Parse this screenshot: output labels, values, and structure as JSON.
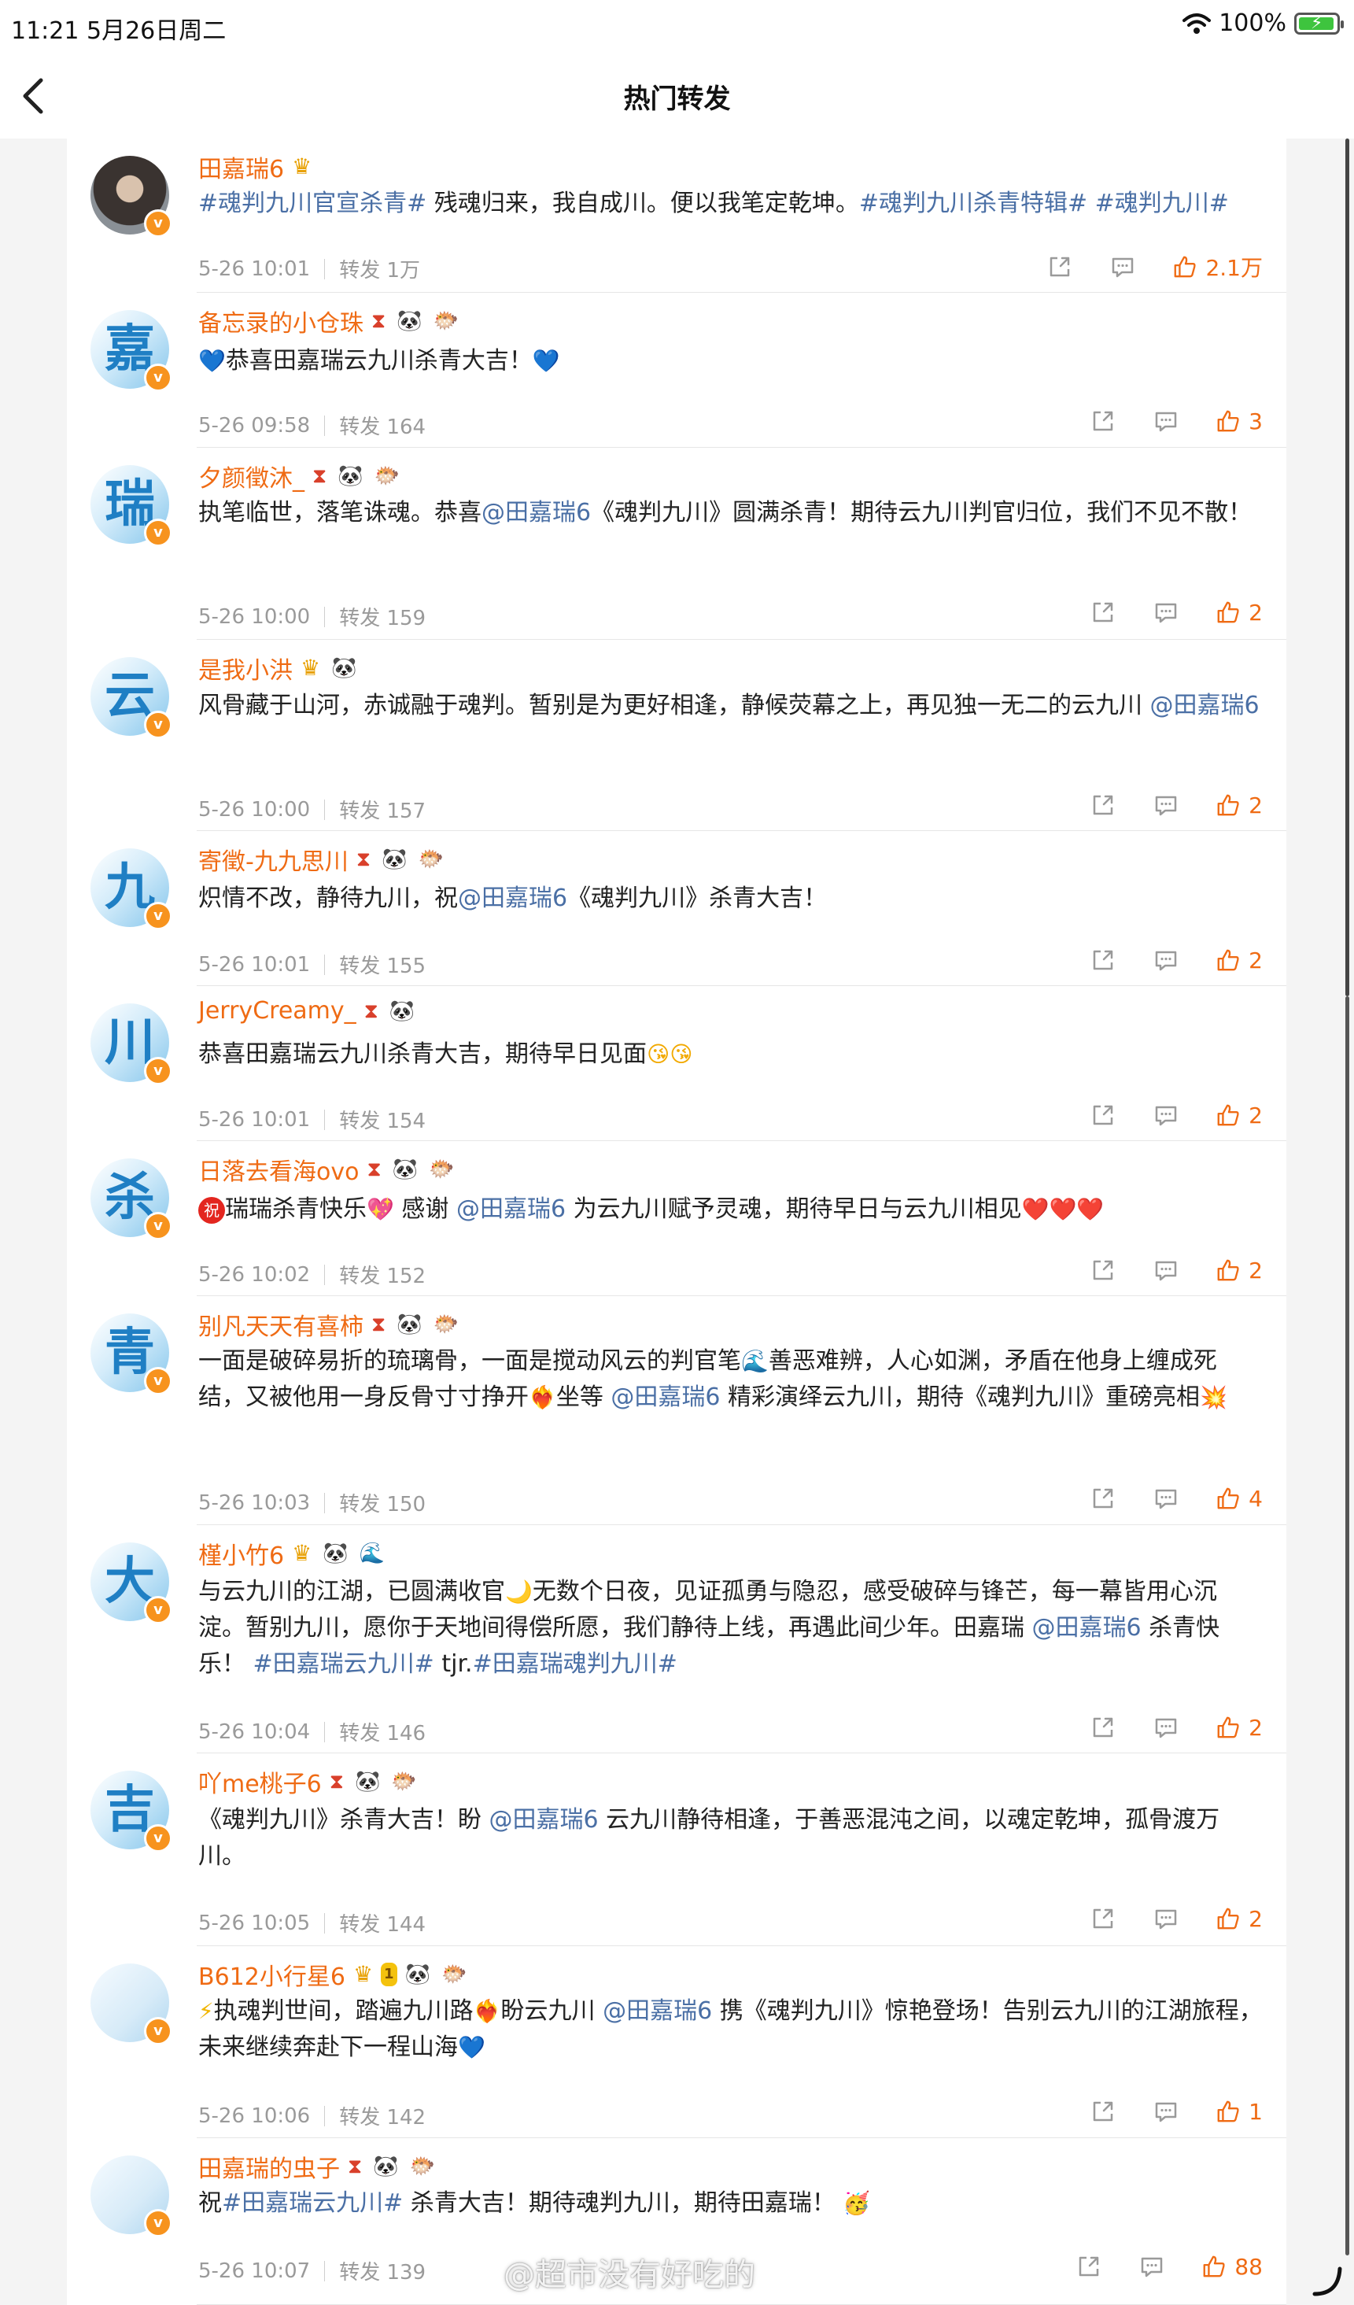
{
  "status_bar": {
    "time_date": "11:21  5月26日周二",
    "battery": "100%"
  },
  "nav": {
    "title": "热门转发",
    "back_icon": "chevron-left-icon"
  },
  "watermark": "@超市没有好吃的",
  "items": [
    {
      "avatar_char": "",
      "avatar_style": "dark",
      "name": "田嘉瑞6",
      "badges": [
        "crown"
      ],
      "content": [
        {
          "t": "tag",
          "v": "#魂判九川官宣杀青#"
        },
        {
          "t": "text",
          "v": " 残魂归来，我自成川。便以我笔定乾坤。"
        },
        {
          "t": "tag",
          "v": "#魂判九川杀青特辑#"
        },
        {
          "t": "text",
          "v": " "
        },
        {
          "t": "tag",
          "v": "#魂判九川#"
        }
      ],
      "time": "5-26 10:01",
      "repost": "转发 1万",
      "likes": "2.1万"
    },
    {
      "avatar_char": "嘉",
      "name": "备忘录的小仓珠",
      "badges": [
        "hourglass",
        "panda",
        "fish"
      ],
      "content": [
        {
          "t": "emoji",
          "v": "💙",
          "c": "e-heart"
        },
        {
          "t": "text",
          "v": "恭喜田嘉瑞云九川杀青大吉！"
        },
        {
          "t": "emoji",
          "v": "💙",
          "c": "e-heart"
        }
      ],
      "time": "5-26 09:58",
      "repost": "转发 164",
      "likes": "3"
    },
    {
      "avatar_char": "瑞",
      "name": "夕颜徵沐_",
      "badges": [
        "hourglass",
        "panda",
        "fish"
      ],
      "content": [
        {
          "t": "text",
          "v": "执笔临世，落笔诛魂。恭喜"
        },
        {
          "t": "mention",
          "v": "@田嘉瑞6"
        },
        {
          "t": "text",
          "v": "《魂判九川》圆满杀青！期待云九川判官归位，我们不见不散！"
        }
      ],
      "time": "5-26 10:00",
      "repost": "转发 159",
      "likes": "2"
    },
    {
      "avatar_char": "云",
      "name": "是我小洪",
      "badges": [
        "crown",
        "panda"
      ],
      "content": [
        {
          "t": "text",
          "v": "风骨藏于山河，赤诚融于魂判。暂别是为更好相逢，静候荧幕之上，再见独一无二的云九川 "
        },
        {
          "t": "mention",
          "v": "@田嘉瑞6"
        }
      ],
      "time": "5-26 10:00",
      "repost": "转发 157",
      "likes": "2"
    },
    {
      "avatar_char": "九",
      "name": "寄徵-九九思川",
      "badges": [
        "hourglass",
        "panda",
        "fish"
      ],
      "content": [
        {
          "t": "text",
          "v": "炽情不改，静待九川，祝"
        },
        {
          "t": "mention",
          "v": "@田嘉瑞6"
        },
        {
          "t": "text",
          "v": "《魂判九川》杀青大吉！"
        }
      ],
      "time": "5-26 10:01",
      "repost": "转发 155",
      "likes": "2"
    },
    {
      "avatar_char": "川",
      "name": "JerryCreamy_",
      "badges": [
        "hourglass",
        "panda"
      ],
      "content": [
        {
          "t": "text",
          "v": "恭喜田嘉瑞云九川杀青大吉，期待早日见面"
        },
        {
          "t": "emoji",
          "v": "😘😘",
          "c": "e-face"
        }
      ],
      "time": "5-26 10:01",
      "repost": "转发 154",
      "likes": "2"
    },
    {
      "avatar_char": "杀",
      "name": "日落去看海ovo",
      "badges": [
        "hourglass",
        "panda",
        "fish"
      ],
      "content": [
        {
          "t": "zhu",
          "v": "祝"
        },
        {
          "t": "text",
          "v": "瑞瑞杀青快乐"
        },
        {
          "t": "emoji",
          "v": "💖",
          "c": "e-red"
        },
        {
          "t": "text",
          "v": " 感谢 "
        },
        {
          "t": "mention",
          "v": "@田嘉瑞6"
        },
        {
          "t": "text",
          "v": " 为云九川赋予灵魂，期待早日与云九川相见"
        },
        {
          "t": "emoji",
          "v": "❤️❤️❤️",
          "c": "e-red"
        }
      ],
      "time": "5-26 10:02",
      "repost": "转发 152",
      "likes": "2"
    },
    {
      "avatar_char": "青",
      "name": "别凡天天有喜柿",
      "badges": [
        "hourglass",
        "panda",
        "fish"
      ],
      "content": [
        {
          "t": "text",
          "v": "一面是破碎易折的琉璃骨，一面是搅动风云的判官笔"
        },
        {
          "t": "emoji",
          "v": "🌊",
          "c": "e-heart"
        },
        {
          "t": "text",
          "v": "善恶难辨，人心如渊，矛盾在他身上缠成死结，又被他用一身反骨寸寸挣开"
        },
        {
          "t": "emoji",
          "v": "❤️‍🔥",
          "c": "e-red"
        },
        {
          "t": "text",
          "v": "坐等 "
        },
        {
          "t": "mention",
          "v": "@田嘉瑞6"
        },
        {
          "t": "text",
          "v": " 精彩演绎云九川，期待《魂判九川》重磅亮相"
        },
        {
          "t": "emoji",
          "v": "💥",
          "c": "e-fire"
        }
      ],
      "time": "5-26 10:03",
      "repost": "转发 150",
      "likes": "4"
    },
    {
      "avatar_char": "大",
      "name": "槿小竹6",
      "badges": [
        "crown",
        "panda",
        "wave"
      ],
      "content": [
        {
          "t": "text",
          "v": "与云九川的江湖，已圆满收官"
        },
        {
          "t": "emoji",
          "v": "🌙",
          "c": "e-moon"
        },
        {
          "t": "text",
          "v": "无数个日夜，见证孤勇与隐忍，感受破碎与锋芒，每一幕皆用心沉淀。暂别九川，愿你于天地间得偿所愿，我们静待上线，再遇此间少年。田嘉瑞 "
        },
        {
          "t": "mention",
          "v": "@田嘉瑞6"
        },
        {
          "t": "text",
          "v": " 杀青快乐！ "
        },
        {
          "t": "tag",
          "v": "#田嘉瑞云九川#"
        },
        {
          "t": "text",
          "v": " tjr."
        },
        {
          "t": "tag",
          "v": "#田嘉瑞魂判九川#"
        }
      ],
      "time": "5-26 10:04",
      "repost": "转发 146",
      "likes": "2"
    },
    {
      "avatar_char": "吉",
      "name": "吖me桃子6",
      "badges": [
        "hourglass",
        "panda",
        "fish"
      ],
      "content": [
        {
          "t": "text",
          "v": "《魂判九川》杀青大吉！盼 "
        },
        {
          "t": "mention",
          "v": "@田嘉瑞6"
        },
        {
          "t": "text",
          "v": " 云九川静待相逢，于善恶混沌之间，以魂定乾坤，孤骨渡万川。"
        }
      ],
      "time": "5-26 10:05",
      "repost": "转发 144",
      "likes": "2"
    },
    {
      "avatar_char": "",
      "avatar_style": "pale",
      "name": "B612小行星6",
      "badges": [
        "crown",
        "lv",
        "panda",
        "fish"
      ],
      "lv": "1",
      "content": [
        {
          "t": "emoji",
          "v": "⚡",
          "c": "e-bolt"
        },
        {
          "t": "text",
          "v": "执魂判世间，踏遍九川路"
        },
        {
          "t": "emoji",
          "v": "❤️‍🔥",
          "c": "e-red"
        },
        {
          "t": "text",
          "v": "盼云九川 "
        },
        {
          "t": "mention",
          "v": "@田嘉瑞6"
        },
        {
          "t": "text",
          "v": " 携《魂判九川》惊艳登场！告别云九川的江湖旅程，未来继续奔赴下一程山海"
        },
        {
          "t": "emoji",
          "v": "💙",
          "c": "e-heart"
        }
      ],
      "time": "5-26 10:06",
      "repost": "转发 142",
      "likes": "1"
    },
    {
      "avatar_char": "",
      "avatar_style": "pale",
      "name": "田嘉瑞的虫子",
      "badges": [
        "hourglass",
        "panda",
        "fish"
      ],
      "content": [
        {
          "t": "text",
          "v": "祝"
        },
        {
          "t": "tag",
          "v": "#田嘉瑞云九川#"
        },
        {
          "t": "text",
          "v": " 杀青大吉！期待魂判九川，期待田嘉瑞！ "
        },
        {
          "t": "emoji",
          "v": "🥳",
          "c": "e-face"
        }
      ],
      "time": "5-26 10:07",
      "repost": "转发 139",
      "likes": "88"
    }
  ]
}
